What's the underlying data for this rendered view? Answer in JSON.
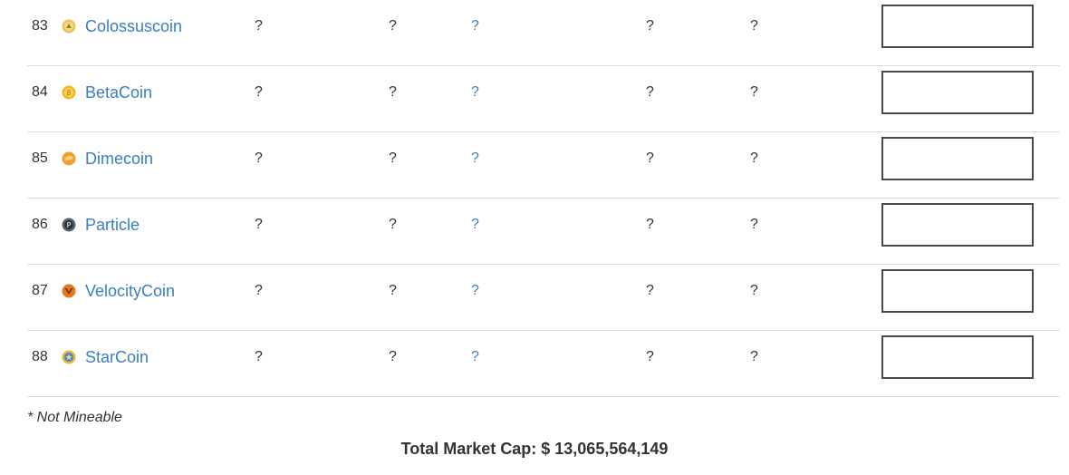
{
  "rows": [
    {
      "rank": "83",
      "name": "Colossuscoin",
      "icon": "colossuscoin-icon",
      "market_cap": "?",
      "price": "?",
      "supply": "?",
      "volume": "?",
      "change": "?"
    },
    {
      "rank": "84",
      "name": "BetaCoin",
      "icon": "betacoin-icon",
      "market_cap": "?",
      "price": "?",
      "supply": "?",
      "volume": "?",
      "change": "?"
    },
    {
      "rank": "85",
      "name": "Dimecoin",
      "icon": "dimecoin-icon",
      "market_cap": "?",
      "price": "?",
      "supply": "?",
      "volume": "?",
      "change": "?"
    },
    {
      "rank": "86",
      "name": "Particle",
      "icon": "particle-icon",
      "market_cap": "?",
      "price": "?",
      "supply": "?",
      "volume": "?",
      "change": "?"
    },
    {
      "rank": "87",
      "name": "VelocityCoin",
      "icon": "velocitycoin-icon",
      "market_cap": "?",
      "price": "?",
      "supply": "?",
      "volume": "?",
      "change": "?"
    },
    {
      "rank": "88",
      "name": "StarCoin",
      "icon": "starcoin-icon",
      "market_cap": "?",
      "price": "?",
      "supply": "?",
      "volume": "?",
      "change": "?"
    }
  ],
  "footer": {
    "note": "* Not Mineable",
    "total_market_cap": "Total Market Cap: $ 13,065,564,149"
  },
  "colors": {
    "link": "#3a7fc0",
    "text": "#333333",
    "divider": "#dddddd",
    "chart_border": "#4a4a4a"
  }
}
